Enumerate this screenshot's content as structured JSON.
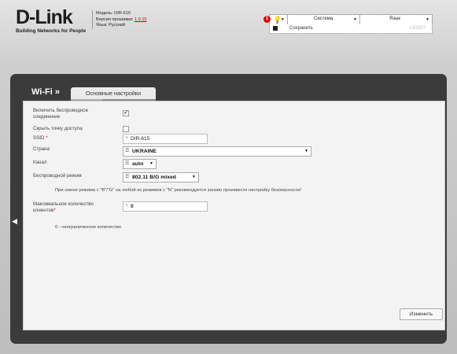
{
  "brand": {
    "logo": "D-Link",
    "tagline": "Building Networks for People"
  },
  "device": {
    "model_line": "Модель: DIR-615",
    "firmware_prefix": "Версия прошивки: ",
    "firmware_version": "1.0.15",
    "lang_line": "Язык: Русский"
  },
  "topbar": {
    "notify_count": "1",
    "menu_system": "Система",
    "menu_language": "Язык",
    "save_label": "Сохранить",
    "extra_label": "LEGO?"
  },
  "page": {
    "section": "Wi-Fi »",
    "tab": "Основные настройки",
    "back_glyph": "◀"
  },
  "form": {
    "enable_label_1": "Включить беспроводное",
    "enable_label_2": "соединение",
    "enable_checked": true,
    "hide_ap_label": "Скрыть точку доступа",
    "hide_ap_checked": false,
    "ssid_label": "SSID",
    "ssid_value": "DIR-615",
    "country_label": "Страна",
    "country_value": "UKRAINE",
    "channel_label": "Канал",
    "channel_value": "auto",
    "mode_label": "Беспроводной режим",
    "mode_value": "802.11 B/G mixed",
    "mode_note": "При смене режима с \"B\"/\"G\" на любой из режимов с \"N\" рекомендуется заново произвести настройку безопасности!",
    "maxclients_label_1": "Максимальное количество",
    "maxclients_label_2": "клиентов",
    "maxclients_value": "0",
    "maxclients_note": "0 - неограниченное количество",
    "apply_button": "Изменить"
  }
}
